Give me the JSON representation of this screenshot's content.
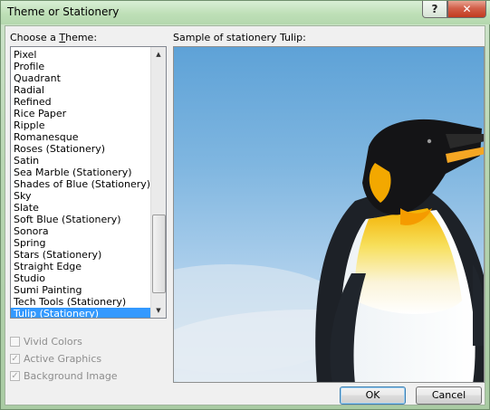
{
  "window": {
    "title": "Theme or Stationery"
  },
  "caption_buttons": {
    "help": "?",
    "close": "✕"
  },
  "theme_list": {
    "label_prefix": "Choose a ",
    "label_underlined": "T",
    "label_suffix": "heme:",
    "items": [
      "Pixel",
      "Profile",
      "Quadrant",
      "Radial",
      "Refined",
      "Rice Paper",
      "Ripple",
      "Romanesque",
      "Roses (Stationery)",
      "Satin",
      "Sea Marble (Stationery)",
      "Shades of Blue (Stationery)",
      "Sky",
      "Slate",
      "Soft Blue (Stationery)",
      "Sonora",
      "Spring",
      "Stars (Stationery)",
      "Straight Edge",
      "Studio",
      "Sumi Painting",
      "Tech Tools (Stationery)",
      "Tulip (Stationery)"
    ],
    "selected": "Tulip (Stationery)"
  },
  "options": {
    "vivid_colors": {
      "label": "Vivid Colors",
      "checked": false,
      "enabled": false
    },
    "active_graphics": {
      "label": "Active Graphics",
      "checked": true,
      "enabled": false
    },
    "background_image": {
      "label": "Background Image",
      "checked": true,
      "enabled": false
    }
  },
  "preview": {
    "label": "Sample of stationery Tulip:"
  },
  "buttons": {
    "ok": "OK",
    "cancel": "Cancel"
  },
  "colors": {
    "selection": "#3399ff",
    "sky": "#7fb6e0",
    "beak": "#f5a623"
  }
}
